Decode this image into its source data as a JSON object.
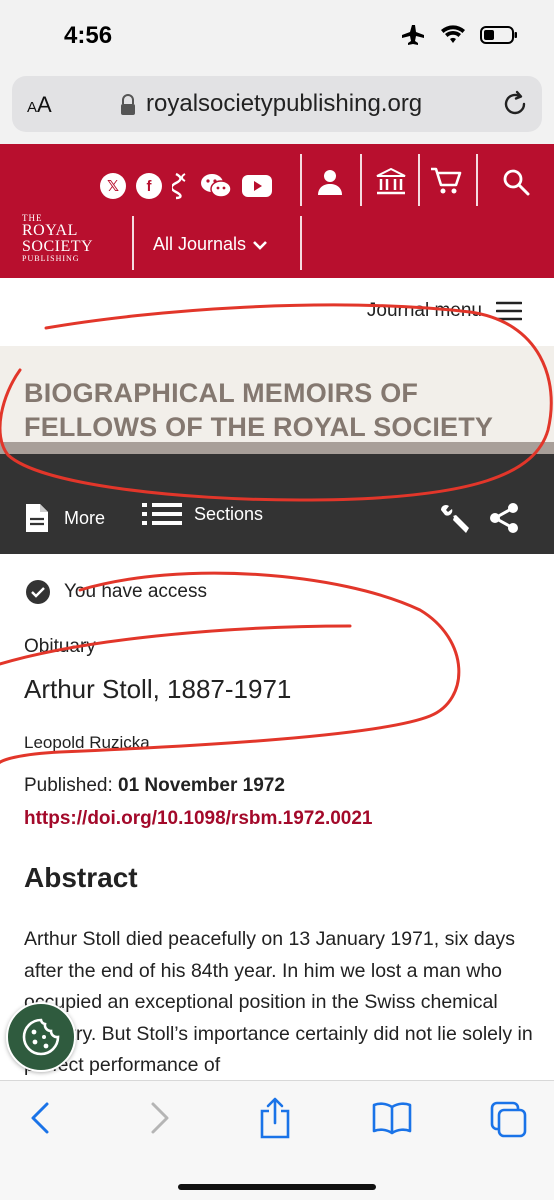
{
  "status": {
    "time": "4:56"
  },
  "browser": {
    "text_size": "AA",
    "url": "royalsocietypublishing.org"
  },
  "site": {
    "social": [
      "x-icon",
      "facebook-icon",
      "altmetric-icon",
      "wechat-icon",
      "youtube-icon"
    ],
    "logo": {
      "line1": "THE",
      "line2": "ROYAL",
      "line3": "SOCIETY",
      "line4": "PUBLISHING"
    },
    "all_journals": "All Journals",
    "brand_color": "#b80f2e"
  },
  "journal": {
    "menu_label": "Journal menu",
    "title_line1": "BIOGRAPHICAL MEMOIRS OF",
    "title_line2": "FELLOWS OF THE ROYAL SOCIETY"
  },
  "toolbar": {
    "more": "More",
    "sections": "Sections"
  },
  "article": {
    "access": "You have access",
    "category": "Obituary",
    "title": "Arthur Stoll, 1887-1971",
    "author": "Leopold Ruzicka",
    "published_label": "Published:",
    "published_date": "01 November 1972",
    "doi": "https://doi.org/10.1098/rsbm.1972.0021",
    "abstract_heading": "Abstract",
    "abstract": "Arthur Stoll died peacefully on 13 January 1971, six days after the end of his 84th year. In him we lost a man who occupied an exceptional position in the Swiss chemical industry. But Stoll’s importance certainly did not lie solely in perfect performance of"
  }
}
